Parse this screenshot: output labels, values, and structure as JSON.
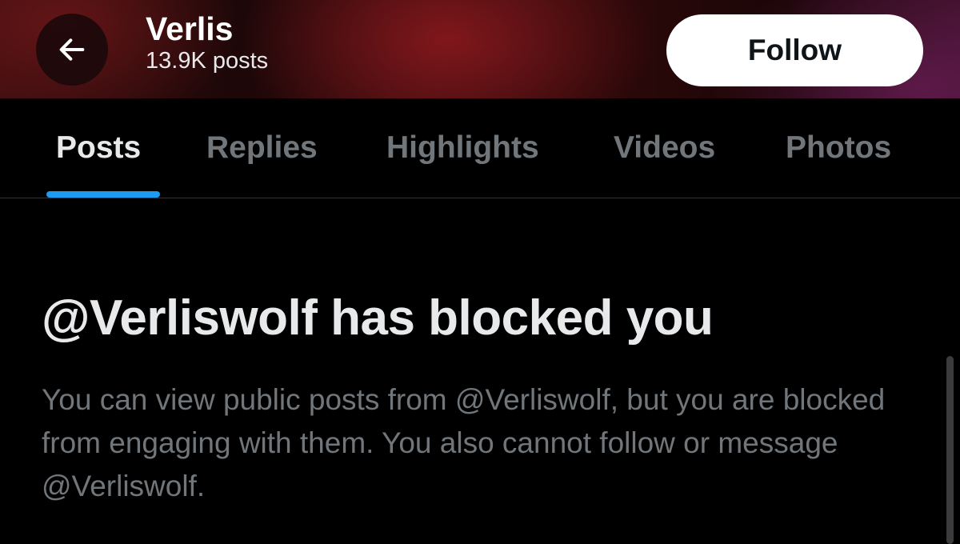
{
  "header": {
    "profile_name": "Verlis",
    "post_count": "13.9K posts",
    "follow_label": "Follow",
    "back_icon": "arrow-left-icon"
  },
  "tabs": [
    {
      "label": "Posts",
      "active": true
    },
    {
      "label": "Replies",
      "active": false
    },
    {
      "label": "Highlights",
      "active": false
    },
    {
      "label": "Videos",
      "active": false
    },
    {
      "label": "Photos",
      "active": false
    }
  ],
  "blocked_notice": {
    "title": "@Verliswolf has blocked you",
    "description": "You can view public posts from @Verliswolf, but you are blocked from engaging with them. You also cannot follow or message @Verliswolf."
  },
  "colors": {
    "accent": "#1d9bf0",
    "background": "#000000",
    "primary_text": "#e7e9ea",
    "secondary_text": "#71767b"
  }
}
